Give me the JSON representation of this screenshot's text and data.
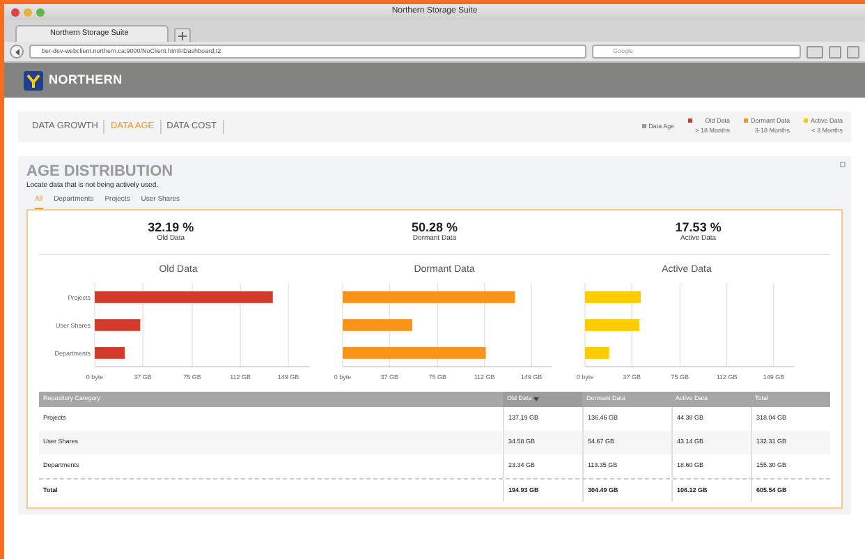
{
  "window": {
    "title": "Northern Storage Suite"
  },
  "browser": {
    "tab": "Northern Storage Suite",
    "url": "ber-dev-webclient.northern.ca:9000/NoClient.html#Dashboard;t2",
    "search_placeholder": "Google"
  },
  "header": {
    "logo_text": "NORTHERN"
  },
  "nav": [
    {
      "label": "DATA GROWTH",
      "selected": false
    },
    {
      "label": "DATA AGE",
      "selected": true
    },
    {
      "label": "DATA COST",
      "selected": false
    }
  ],
  "legend": [
    {
      "label": "Data Age",
      "color": "#999999"
    },
    {
      "label": "Old Data",
      "sub": "> 18 Months",
      "color": "#d13b2a"
    },
    {
      "label": "Dormant Data",
      "sub": "3-18 Months",
      "color": "#f7941d"
    },
    {
      "label": "Active Data",
      "sub": "< 3 Months",
      "color": "#ffcc00"
    }
  ],
  "panel": {
    "title": "AGE DISTRIBUTION",
    "subtitle": "Locate data that is not being actively used.",
    "tabs": [
      {
        "label": "All",
        "selected": true
      },
      {
        "label": "Departments",
        "selected": false
      },
      {
        "label": "Projects",
        "selected": false
      },
      {
        "label": "User Shares",
        "selected": false
      }
    ],
    "stats": [
      {
        "value": "32.19 %",
        "label": "Old Data"
      },
      {
        "value": "50.28 %",
        "label": "Dormant Data"
      },
      {
        "value": "17.53 %",
        "label": "Active Data"
      }
    ],
    "charts": [
      {
        "chart_data": {
          "type": "bar",
          "orientation": "horizontal",
          "grid": true,
          "categories": [
            "Projects",
            "User Shares",
            "Departments"
          ],
          "series": [
            {
              "name": "Old Data",
              "color": "#d13b2a",
              "values": [
                137,
                35,
                23
              ]
            }
          ],
          "xlim": [
            0,
            165
          ],
          "xticks": [
            {
              "value": 0,
              "label": "0 byte"
            },
            {
              "value": 37,
              "label": "37 GB"
            },
            {
              "value": 75,
              "label": "75 GB"
            },
            {
              "value": 112,
              "label": "112 GB"
            },
            {
              "value": 149,
              "label": "149 GB"
            }
          ]
        }
      },
      {
        "chart_data": {
          "type": "bar",
          "orientation": "horizontal",
          "grid": true,
          "series": [
            {
              "name": "Dormant Data",
              "color": "#f7941d",
              "values": [
                136,
                55,
                113
              ]
            }
          ],
          "xlim": [
            0,
            165
          ],
          "xticks": [
            {
              "value": 0,
              "label": "0 byte"
            },
            {
              "value": 37,
              "label": "37 GB"
            },
            {
              "value": 75,
              "label": "75 GB"
            },
            {
              "value": 112,
              "label": "112 GB"
            },
            {
              "value": 149,
              "label": "149 GB"
            }
          ]
        }
      },
      {
        "chart_data": {
          "type": "bar",
          "orientation": "horizontal",
          "grid": true,
          "series": [
            {
              "name": "Active Data",
              "color": "#ffcc00",
              "values": [
                44,
                43,
                19
              ]
            }
          ],
          "xlim": [
            0,
            165
          ],
          "xticks": [
            {
              "value": 0,
              "label": "0 byte"
            },
            {
              "value": 37,
              "label": "37 GB"
            },
            {
              "value": 75,
              "label": "75 GB"
            },
            {
              "value": 112,
              "label": "112 GB"
            },
            {
              "value": 149,
              "label": "149 GB"
            }
          ]
        }
      }
    ],
    "table": {
      "columns": [
        {
          "label": "Repository Category",
          "sorted": false
        },
        {
          "label": "Old Data",
          "sorted": true
        },
        {
          "label": "Dormant Data",
          "sorted": false
        },
        {
          "label": "Active Data",
          "sorted": false
        },
        {
          "label": "Total",
          "sorted": false
        }
      ],
      "rows": [
        [
          "Projects",
          "137.19 GB",
          "136.46 GB",
          "44.38 GB",
          "318.04 GB"
        ],
        [
          "User Shares",
          "34.58 GB",
          "54.67 GB",
          "43.14 GB",
          "132.31 GB"
        ],
        [
          "Departments",
          "23.34 GB",
          "113.35 GB",
          "18.60 GB",
          "155.30 GB"
        ]
      ],
      "total": [
        "Total",
        "194.93 GB",
        "304.49 GB",
        "106.12 GB",
        "605.54 GB"
      ]
    }
  }
}
